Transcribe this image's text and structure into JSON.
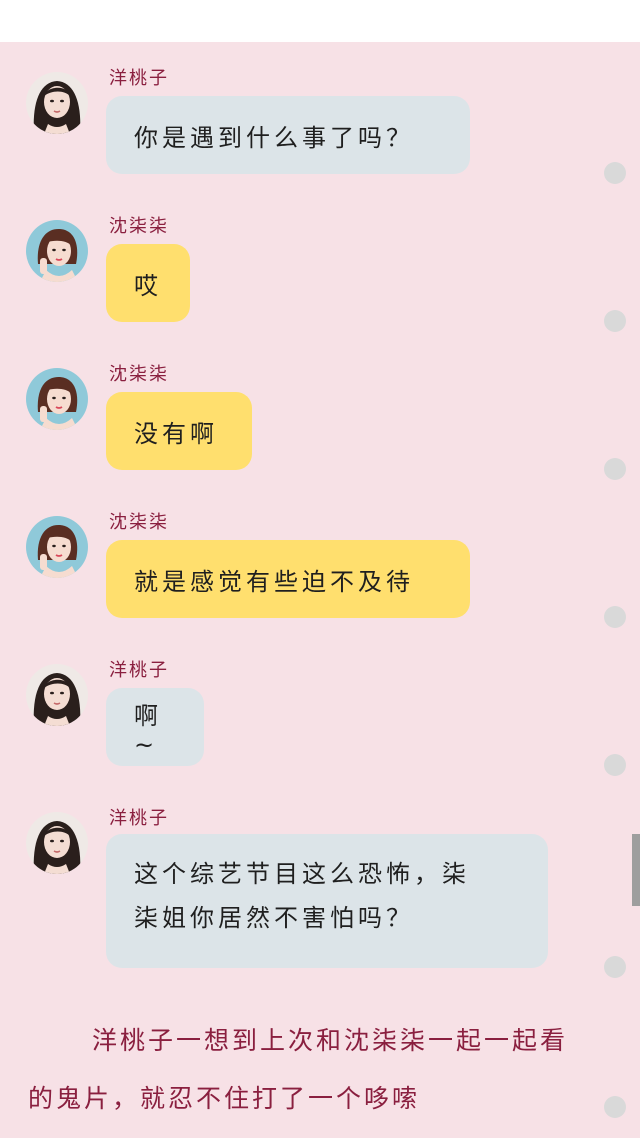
{
  "messages": [
    {
      "sender": "洋桃子",
      "text": "你是遇到什么事了吗？",
      "lines": [],
      "style": "gray",
      "avatar_icon": "girl-longhair-avatar-icon"
    },
    {
      "sender": "沈柒柒",
      "text": "哎",
      "lines": [],
      "style": "yellow",
      "avatar_icon": "girl-pose-avatar-icon"
    },
    {
      "sender": "沈柒柒",
      "text": "没有啊",
      "lines": [],
      "style": "yellow",
      "avatar_icon": "girl-pose-avatar-icon"
    },
    {
      "sender": "沈柒柒",
      "text": "就是感觉有些迫不及待",
      "lines": [],
      "style": "yellow",
      "avatar_icon": "girl-pose-avatar-icon"
    },
    {
      "sender": "洋桃子",
      "text": "啊~",
      "lines": [],
      "style": "gray",
      "avatar_icon": "girl-longhair-avatar-icon"
    },
    {
      "sender": "洋桃子",
      "text": "",
      "lines": [
        "这个综艺节目这么恐怖，柒",
        "柒姐你居然不害怕吗？"
      ],
      "style": "gray",
      "avatar_icon": "girl-longhair-avatar-icon"
    }
  ],
  "narration": "洋桃子一想到上次和沈柒柒一起一起看的鬼片，就忍不住打了一个哆嗦",
  "colors": {
    "background": "#f7e1e6",
    "bubble_gray": "#dce4e8",
    "bubble_yellow": "#ffdf6e",
    "sender_name": "#8a1f3f"
  }
}
